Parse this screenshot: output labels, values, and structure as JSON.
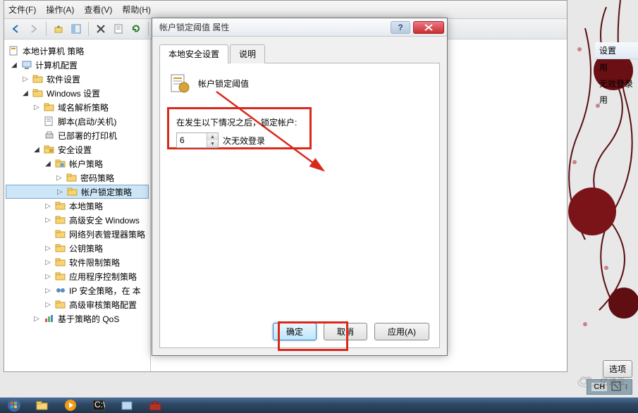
{
  "menu": {
    "file": "文件(F)",
    "action": "操作(A)",
    "view": "查看(V)",
    "help": "帮助(H)"
  },
  "tree": {
    "root": "本地计算机 策略",
    "computer_config": "计算机配置",
    "software_settings": "软件设置",
    "windows_settings": "Windows 设置",
    "name_resolution": "域名解析策略",
    "scripts": "脚本(启动/关机)",
    "deployed_printers": "已部署的打印机",
    "security_settings": "安全设置",
    "account_policies": "帐户策略",
    "password_policy": "密码策略",
    "lockout_policy": "帐户锁定策略",
    "local_policies": "本地策略",
    "advanced_firewall": "高级安全 Windows",
    "network_list": "网络列表管理器策略",
    "public_key": "公钥策略",
    "software_restriction": "软件限制策略",
    "app_control": "应用程序控制策略",
    "ip_security": "IP 安全策略，在 本",
    "advanced_audit": "高级审核策略配置",
    "qos": "基于策略的 QoS"
  },
  "right_col": {
    "hdr": "设置",
    "r1": "用",
    "r2": "无效登录",
    "r3": "用"
  },
  "dialog": {
    "title": "帐户锁定阈值 属性",
    "tab_local": "本地安全设置",
    "tab_explain": "说明",
    "heading": "帐户锁定阈值",
    "prompt": "在发生以下情况之后，锁定帐户:",
    "value": "6",
    "unit": "次无效登录",
    "ok": "确定",
    "cancel": "取消",
    "apply": "应用(A)"
  },
  "options_btn": "选项",
  "lang": "CH",
  "watermark": "亿速云"
}
